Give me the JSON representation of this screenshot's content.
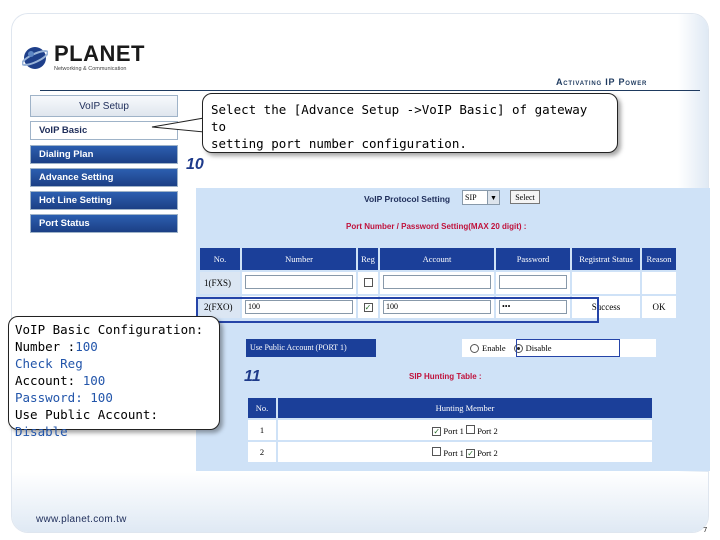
{
  "brand": {
    "name": "PLANET",
    "tagline": "Networking & Communication",
    "slogan": "Activating IP Power",
    "url": "www.planet.com.tw",
    "page_number": "7"
  },
  "menu": {
    "header": "VoIP Setup",
    "items": [
      "VoIP Basic",
      "Dialing Plan",
      "Advance Setting",
      "Hot Line Setting",
      "Port Status"
    ]
  },
  "callout_top": {
    "line1": "Select the [Advance Setup ->VoIP Basic] of gateway  to",
    "line2": "setting port number configuration."
  },
  "callout_left": {
    "title": "VoIP Basic Configuration:",
    "number_label": "Number :",
    "number_value": "100",
    "check": "Check Reg",
    "account_label": "Account:",
    "account_value": "100",
    "password_label": "Password:",
    "password_value": "100",
    "public_label": "Use Public Account:",
    "public_value": "Disable"
  },
  "steps": {
    "a": "10",
    "b": "11"
  },
  "form": {
    "protocol_label": "VoIP Protocol Setting",
    "protocol_value": "SIP",
    "select_button": "Select",
    "port_section": "Port Number / Password Setting(MAX 20 digit) :",
    "columns": [
      "No.",
      "Number",
      "Reg",
      "Account",
      "Password",
      "Registrat Status",
      "Reason"
    ],
    "rows": [
      {
        "no": "1(FXS)",
        "number": "",
        "reg": false,
        "account": "",
        "password": "",
        "status": "",
        "reason": ""
      },
      {
        "no": "2(FXO)",
        "number": "100",
        "reg": true,
        "account": "100",
        "password": "•••",
        "status": "Success",
        "reason": "OK"
      }
    ],
    "public_account_label": "Use Public Account (PORT 1)",
    "public_enable": "Enable",
    "public_disable": "Disable",
    "public_selected": "Disable",
    "hunting_section": "SIP Hunting Table :",
    "hunting_columns": [
      "No.",
      "Hunting Member"
    ],
    "hunting_rows": [
      {
        "no": "1",
        "p1_label": "Port 1",
        "p1": true,
        "p2_label": "Port 2",
        "p2": false
      },
      {
        "no": "2",
        "p1_label": "Port 1",
        "p1": false,
        "p2_label": "Port 2",
        "p2": true
      }
    ]
  },
  "colors": {
    "accent": "#1b3f99",
    "section_red": "#c0123c",
    "panel_bg": "#cfe2f7"
  }
}
